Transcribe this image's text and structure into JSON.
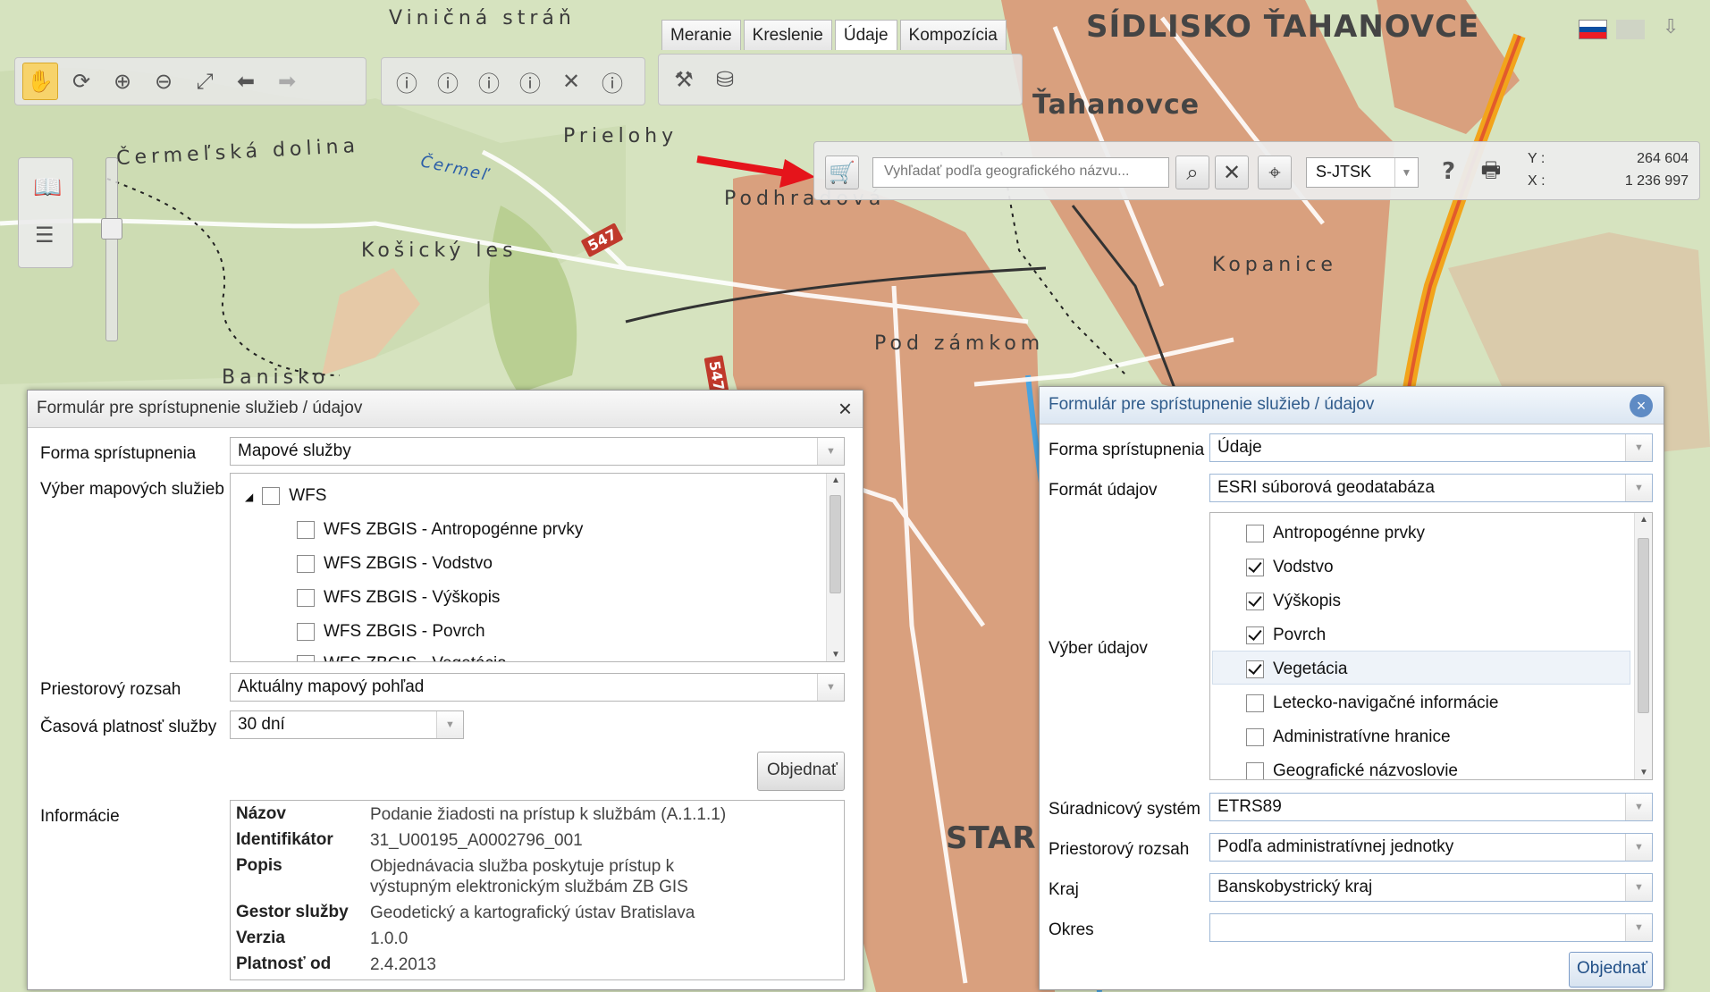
{
  "map": {
    "labels": {
      "vinicna": "Viničná stráň",
      "tahanovce_big": "SÍDLISKO ŤAHANOVCE",
      "tahanovce": "Ťahanovce",
      "prielohy": "Prielohy",
      "crmelska": "Čermeľská dolina",
      "crmel": "Čermeľ",
      "podhradova": "Podhradová",
      "kosicky_les": "Košický les",
      "kopanice": "Kopanice",
      "pod_zamkom": "Pod zámkom",
      "banisko": "Banisko",
      "stare": "STARÉ",
      "road_547a": "547",
      "road_547b": "547"
    }
  },
  "tabs": [
    "Meranie",
    "Kreslenie",
    "Údaje",
    "Kompozícia"
  ],
  "search": {
    "placeholder": "Vyhľadať podľa geografického názvu...",
    "crs": "S-JTSK",
    "help": "?",
    "y_label": "Y :",
    "y_value": "264 604",
    "x_label": "X :",
    "x_value": "1 236 997"
  },
  "left_dialog": {
    "title": "Formulár pre sprístupnenie služieb / údajov",
    "close": "×",
    "forma_label": "Forma sprístupnenia",
    "forma_value": "Mapové služby",
    "vyber_label": "Výber mapových služieb",
    "tree": {
      "root": "WFS",
      "items": [
        "WFS ZBGIS - Antropogénne prvky",
        "WFS ZBGIS - Vodstvo",
        "WFS ZBGIS - Výškopis",
        "WFS ZBGIS - Povrch",
        "WFS ZBGIS - Vegetácia"
      ]
    },
    "rozsah_label": "Priestorový rozsah",
    "rozsah_value": "Aktuálny mapový pohľad",
    "platnost_label": "Časová platnosť služby",
    "platnost_value": "30 dní",
    "order_button": "Objednať",
    "info_label": "Informácie",
    "info": [
      {
        "key": "Názov",
        "value": "Podanie žiadosti na prístup k službám (A.1.1.1)"
      },
      {
        "key": "Identifikátor",
        "value": "31_U00195_A0002796_001"
      },
      {
        "key": "Popis",
        "value": "Objednávacia služba poskytuje prístup k výstupným elektronickým službám ZB GIS"
      },
      {
        "key": "Gestor služby",
        "value": "Geodetický a kartografický ústav Bratislava"
      },
      {
        "key": "Verzia",
        "value": "1.0.0"
      },
      {
        "key": "Platnosť od",
        "value": "2.4.2013"
      }
    ]
  },
  "right_dialog": {
    "title": "Formulár pre sprístupnenie služieb / údajov",
    "close": "×",
    "forma_label": "Forma sprístupnenia",
    "forma_value": "Údaje",
    "format_label": "Formát údajov",
    "format_value": "ESRI súborová geodatabáza",
    "vyber_label": "Výber údajov",
    "items": [
      {
        "label": "Antropogénne prvky",
        "checked": false
      },
      {
        "label": "Vodstvo",
        "checked": true
      },
      {
        "label": "Výškopis",
        "checked": true
      },
      {
        "label": "Povrch",
        "checked": true
      },
      {
        "label": "Vegetácia",
        "checked": true
      },
      {
        "label": "Letecko-navigačné informácie",
        "checked": false
      },
      {
        "label": "Administratívne hranice",
        "checked": false
      },
      {
        "label": "Geografické názvoslovie",
        "checked": false
      }
    ],
    "crs_label": "Súradnicový systém",
    "crs_value": "ETRS89",
    "rozsah_label": "Priestorový rozsah",
    "rozsah_value": "Podľa administratívnej jednotky",
    "kraj_label": "Kraj",
    "kraj_value": "Banskobystrický kraj",
    "okres_label": "Okres",
    "okres_value": "",
    "order_button": "Objednať"
  },
  "colors": {
    "forest": "#d6e3bf",
    "urban": "#d9a07e",
    "highlight": "#f7d36b",
    "arrow": "#e5141b"
  }
}
